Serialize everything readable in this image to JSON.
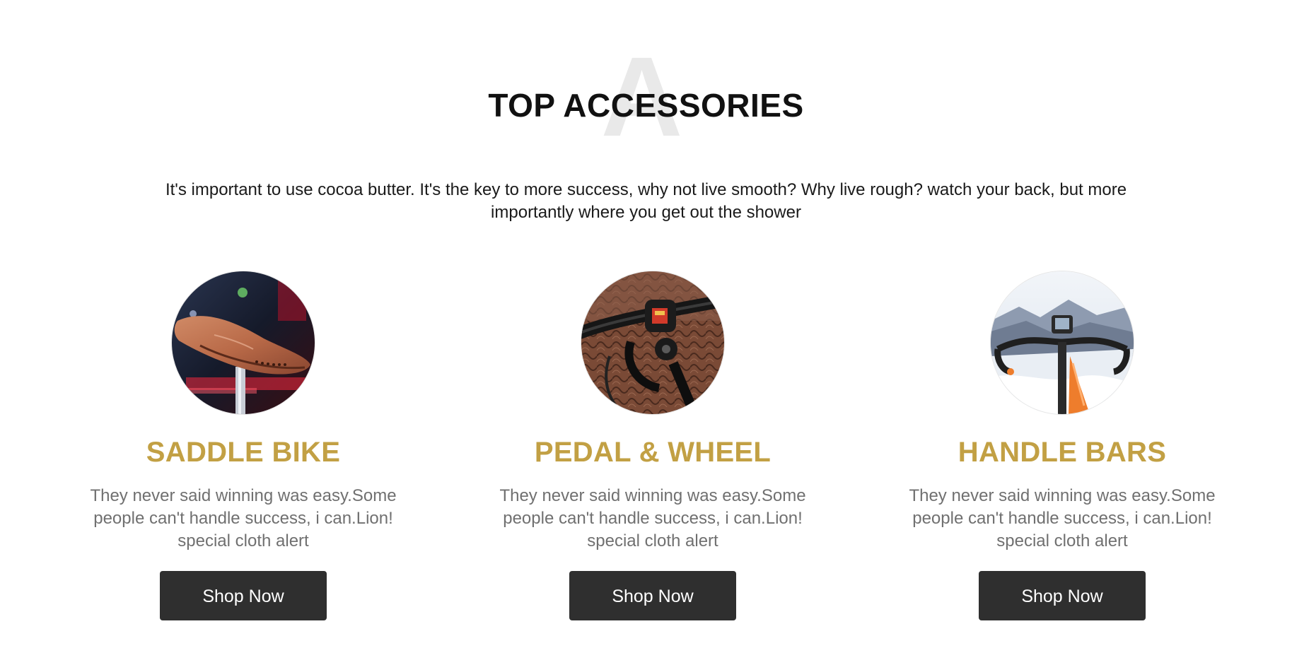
{
  "section": {
    "bg_letter": "A",
    "title": "TOP ACCESSORIES",
    "intro": "It's important to use cocoa butter. It's the key to more success, why not live smooth? Why live rough? watch your back, but more importantly where you get out the shower"
  },
  "cards": [
    {
      "title": "SADDLE BIKE",
      "description": "They never said winning was easy.Some people can't handle success, i can.Lion! special cloth alert",
      "button_label": "Shop Now",
      "image": "saddle-photo"
    },
    {
      "title": "PEDAL & WHEEL",
      "description": "They never said winning was easy.Some people can't handle success, i can.Lion! special cloth alert",
      "button_label": "Shop Now",
      "image": "handlebar-grip-photo"
    },
    {
      "title": "HANDLE BARS",
      "description": "They never said winning was easy.Some people can't handle success, i can.Lion! special cloth alert",
      "button_label": "Shop Now",
      "image": "snowy-handlebars-photo"
    }
  ],
  "colors": {
    "accent": "#c2a044",
    "button_bg": "#2f2f2f",
    "button_text": "#ffffff",
    "body_text": "#707070",
    "heading_text": "#111111",
    "watermark": "#e9e9e9"
  }
}
